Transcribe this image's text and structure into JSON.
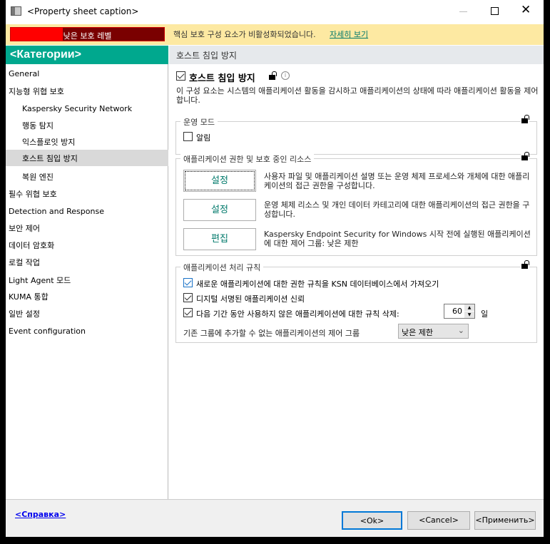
{
  "window": {
    "title": "<Property sheet caption>"
  },
  "banner": {
    "badge": "낮은 보호 레벨",
    "badge_fill_percent": 34,
    "message": "핵심 보호 구성 요소가 비활성화되었습니다.",
    "link": "자세히 보기"
  },
  "sidebar": {
    "header": "<Категории>",
    "items": [
      {
        "label": "General",
        "sub": false
      },
      {
        "label": "지능형 위협 보호",
        "sub": false
      },
      {
        "label": "Kaspersky Security Network",
        "sub": true
      },
      {
        "label": "행동 탐지",
        "sub": true
      },
      {
        "label": "익스플로잇 방지",
        "sub": true
      },
      {
        "label": "호스트 침입 방지",
        "sub": true,
        "selected": true
      },
      {
        "label": "복원 엔진",
        "sub": true
      },
      {
        "label": "필수 위협 보호",
        "sub": false
      },
      {
        "label": "Detection and Response",
        "sub": false
      },
      {
        "label": "보안 제어",
        "sub": false
      },
      {
        "label": "데이터 암호화",
        "sub": false
      },
      {
        "label": "로컬 작업",
        "sub": false
      },
      {
        "label": "Light Agent 모드",
        "sub": false
      },
      {
        "label": "KUMA 통합",
        "sub": false
      },
      {
        "label": "일반 설정",
        "sub": false
      },
      {
        "label": "Event configuration",
        "sub": false
      }
    ]
  },
  "main": {
    "header": "호스트 침입 방지",
    "component_label": "호스트 침입 방지",
    "component_enabled": true,
    "description": "이 구성 요소는 시스템의 애플리케이션 활동을 감시하고 애플리케이션의 상태에 따라 애플리케이션 활동을 제어합니다.",
    "mode_group": {
      "title": "운영 모드",
      "alert_label": "알림",
      "alert_checked": false
    },
    "rights_group": {
      "title": "애플리케이션 권한 및 보호 중인 리소스",
      "rows": [
        {
          "button": "설정",
          "text": "사용자 파일 및 애플리케이션 설명 또는 운영 체제 프로세스와 개체에 대한 애플리케이션의 접근 권한을 구성합니다."
        },
        {
          "button": "설정",
          "text": "운영 체제 리소스 및 개인 데이터 카테고리에 대한 애플리케이션의 접근 권한을 구성합니다."
        },
        {
          "button": "편집",
          "text": "Kaspersky Endpoint Security for Windows 시작 전에 실행된 애플리케이션에 대한 제어 그룹: 낮은 제한"
        }
      ]
    },
    "rules_group": {
      "title": "애플리케이션 처리 규칙",
      "ksn_label": "새로운 애플리케이션에 대한 권한 규칙을 KSN 데이터베이스에서 가져오기",
      "trust_label": "디지털 서명된 애플리케이션 신뢰",
      "delete_label": "다음 기간 동안 사용하지 않은 애플리케이션에 대한 규칙 삭제:",
      "days_value": "60",
      "days_unit": "일",
      "group_label": "기존 그룹에 추가할 수 없는 애플리케이션의 제어 그룹",
      "group_value": "낮은 제한"
    }
  },
  "footer": {
    "help": "<Справка>",
    "ok": "<Ok>",
    "cancel": "<Cancel>",
    "apply": "<Применить>"
  }
}
